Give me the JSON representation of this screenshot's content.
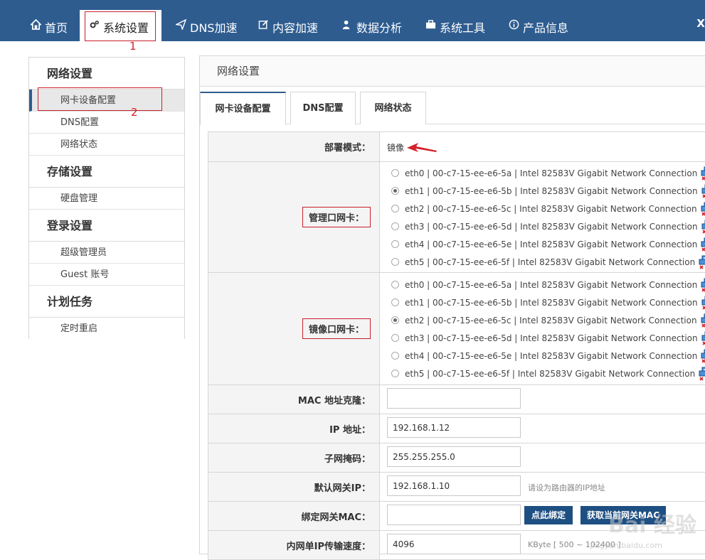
{
  "nav": {
    "items": [
      {
        "label": "首页",
        "icon": "home-icon"
      },
      {
        "label": "系统设置",
        "icon": "gears-icon"
      },
      {
        "label": "DNS加速",
        "icon": "paper-plane-icon"
      },
      {
        "label": "内容加速",
        "icon": "edit-icon"
      },
      {
        "label": "数据分析",
        "icon": "user-chart-icon"
      },
      {
        "label": "系统工具",
        "icon": "briefcase-icon"
      },
      {
        "label": "产品信息",
        "icon": "info-icon"
      }
    ],
    "right_text": "X",
    "annotation_1": "1"
  },
  "sidebar": {
    "annotation_2": "2",
    "sections": [
      {
        "title": "网络设置",
        "items": [
          "网卡设备配置",
          "DNS配置",
          "网络状态"
        ]
      },
      {
        "title": "存储设置",
        "items": [
          "硬盘管理"
        ]
      },
      {
        "title": "登录设置",
        "items": [
          "超级管理员",
          "Guest 账号"
        ]
      },
      {
        "title": "计划任务",
        "items": [
          "定时重启"
        ]
      }
    ]
  },
  "panel": {
    "title": "网络设置",
    "tabs": [
      "网卡设备配置",
      "DNS配置",
      "网络状态"
    ]
  },
  "form": {
    "deploy_mode_label": "部署模式：",
    "deploy_mode_value": "镜像",
    "mgmt_nic_label": "管理口网卡：",
    "mirror_nic_label": "镜像口网卡：",
    "nics": [
      "eth0 | 00-c7-15-ee-e6-5a | Intel 82583V Gigabit Network Connection",
      "eth1 | 00-c7-15-ee-e6-5b | Intel 82583V Gigabit Network Connection",
      "eth2 | 00-c7-15-ee-e6-5c | Intel 82583V Gigabit Network Connection",
      "eth3 | 00-c7-15-ee-e6-5d | Intel 82583V Gigabit Network Connection",
      "eth4 | 00-c7-15-ee-e6-5e | Intel 82583V Gigabit Network Connection",
      "eth5 | 00-c7-15-ee-e6-5f | Intel 82583V Gigabit Network Connection"
    ],
    "mgmt_selected": 1,
    "mirror_selected": 2,
    "mac_clone_label": "MAC 地址克隆：",
    "mac_clone_value": "",
    "ip_label": "IP 地址：",
    "ip_value": "192.168.1.12",
    "mask_label": "子网掩码：",
    "mask_value": "255.255.255.0",
    "gateway_label": "默认网关IP：",
    "gateway_value": "192.168.1.10",
    "gateway_hint": "请设为路由器的IP地址",
    "bind_mac_label": "绑定网关MAC：",
    "bind_mac_value": "",
    "bind_button": "点此绑定",
    "get_mac_button": "获取当前网关MAC",
    "speed_label": "内网单IP传输速度：",
    "speed_value": "4096",
    "speed_hint": "KByte  [ 500 ~ 102400 ]"
  },
  "watermark": {
    "text": "Bai 经验",
    "sub": "jingyan.baidu.com"
  },
  "colors": {
    "nav_bg": "#2e5c8f",
    "accent": "#1e4f82",
    "annotation": "#c8202a"
  }
}
